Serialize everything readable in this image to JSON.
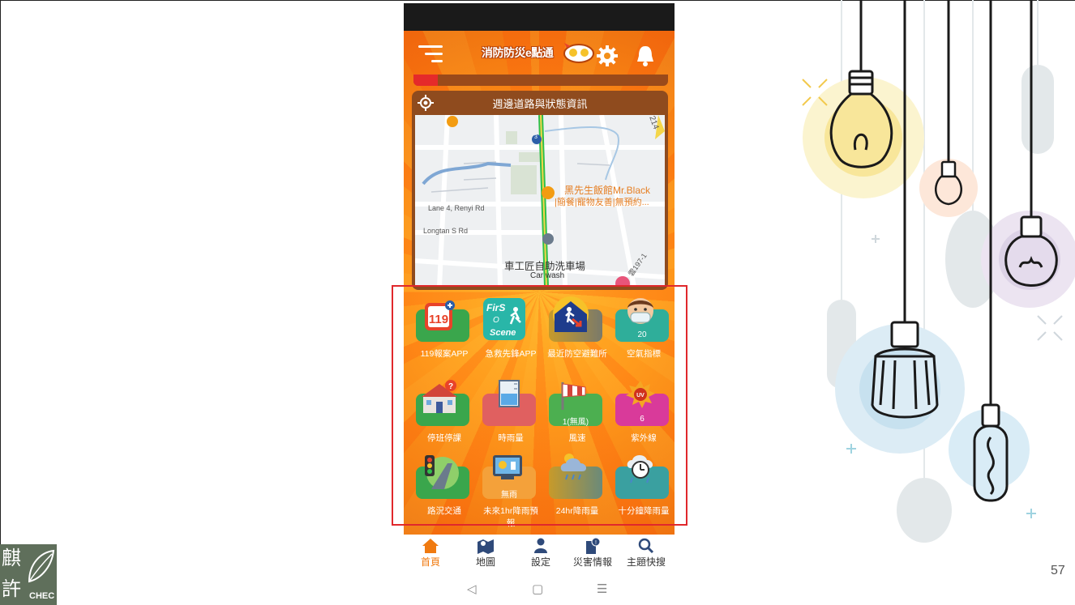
{
  "app": {
    "title": "消防防災e點通"
  },
  "map_card": {
    "header": "週邊道路與狀態資訊",
    "labels": {
      "restaurant_line1": "黑先生飯館Mr.Black",
      "restaurant_line2": "|簡餐|寵物友善|無預約...",
      "road1": "Lane 4, Renyi Rd",
      "road2": "Longtan S Rd",
      "carwash_cn": "車工匠自助洗車場",
      "carwash_en": "Car wash",
      "route_badge": "3",
      "road_code": "雲197-1",
      "top_right": "214"
    }
  },
  "tiles": [
    {
      "label": "119報案APP",
      "value": "",
      "icon": "phone-119-icon",
      "color": "#3aa64c"
    },
    {
      "label": "急救先鋒APP",
      "value": "",
      "icon": "first-on-scene-icon",
      "color": "#ff9a1c"
    },
    {
      "label": "最近防空避難所",
      "value": "",
      "icon": "shelter-icon",
      "color": "#9a8a5a"
    },
    {
      "label": "空氣指標",
      "value": "20",
      "icon": "mask-face-icon",
      "color": "#2fae9a"
    },
    {
      "label": "停班停課",
      "value": "",
      "icon": "school-icon",
      "color": "#3aa64c"
    },
    {
      "label": "時雨量",
      "value": "",
      "icon": "rain-gauge-icon",
      "color": "#e06060"
    },
    {
      "label": "風速",
      "value": "1(無風)",
      "icon": "windsock-icon",
      "color": "#4caf50"
    },
    {
      "label": "紫外線",
      "value": "6",
      "icon": "uv-sun-icon",
      "color": "#d93a9a"
    },
    {
      "label": "路況交通",
      "value": "",
      "icon": "traffic-light-icon",
      "color": "#3aa64c"
    },
    {
      "label": "未來1hr降雨預報",
      "value": "無雨",
      "icon": "weather-monitor-icon",
      "color": "#ff9a1c"
    },
    {
      "label": "24hr降雨量",
      "value": "",
      "icon": "rain-cloud-icon",
      "color": "#9a9a6a"
    },
    {
      "label": "十分鐘降雨量",
      "value": "",
      "icon": "rain-timer-icon",
      "color": "#3aa0a0"
    }
  ],
  "bottom_nav": [
    {
      "label": "首頁",
      "icon": "home-icon",
      "active": true
    },
    {
      "label": "地圖",
      "icon": "map-icon",
      "active": false
    },
    {
      "label": "設定",
      "icon": "person-icon",
      "active": false
    },
    {
      "label": "災害情報",
      "icon": "alert-doc-icon",
      "active": false
    },
    {
      "label": "主題快搜",
      "icon": "search-icon",
      "active": false
    }
  ],
  "android_nav": {
    "back": "◁",
    "home": "▢",
    "recents": "☰"
  },
  "slide": {
    "page_number": "57",
    "logo_char1": "麒",
    "logo_char2": "許",
    "logo_text": "CHEC"
  }
}
